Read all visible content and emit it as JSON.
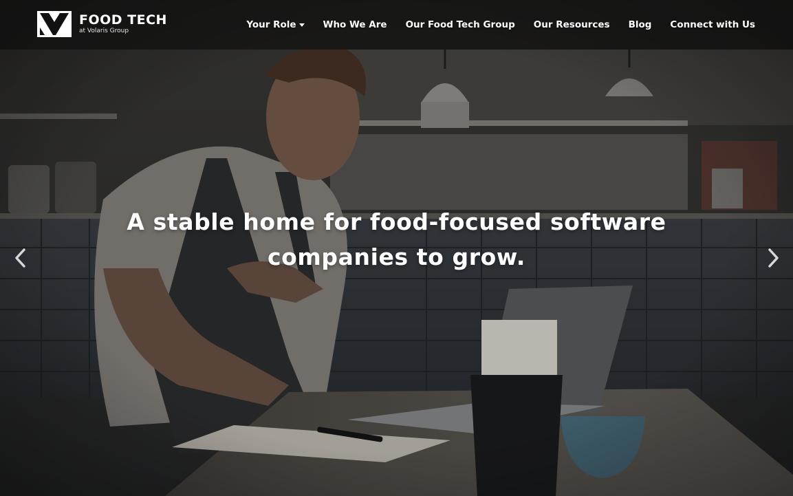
{
  "brand": {
    "name": "FOOD TECH",
    "subtitle": "at Volaris Group"
  },
  "nav": {
    "items": [
      {
        "label": "Your Role",
        "has_dropdown": true
      },
      {
        "label": "Who We Are"
      },
      {
        "label": "Our Food Tech Group"
      },
      {
        "label": "Our Resources"
      },
      {
        "label": "Blog"
      },
      {
        "label": "Connect with Us"
      }
    ]
  },
  "hero": {
    "headline_line1": "A stable home for food-focused software",
    "headline_line2": "companies to grow.",
    "prev_icon": "chevron-left-icon",
    "next_icon": "chevron-right-icon"
  },
  "colors": {
    "header_bg": "#0c0c0c",
    "text": "#ffffff"
  }
}
